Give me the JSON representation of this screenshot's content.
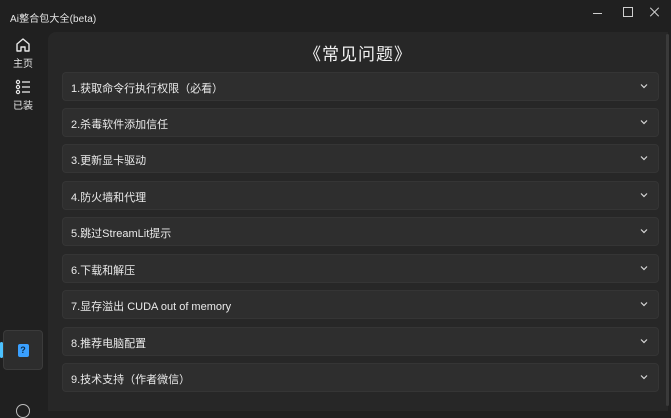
{
  "window": {
    "title": "Ai整合包大全(beta)"
  },
  "sidebar": {
    "items": [
      {
        "label": "主页",
        "icon": "home-icon"
      },
      {
        "label": "已装",
        "icon": "list-icon"
      }
    ],
    "active_item": {
      "icon": "help-book-icon",
      "glyph": "?"
    }
  },
  "main": {
    "title": "《常见问题》",
    "faq": [
      "1.获取命令行执行权限（必看）",
      "2.杀毒软件添加信任",
      "3.更新显卡驱动",
      "4.防火墙和代理",
      "5.跳过StreamLit提示",
      "6.下载和解压",
      "7.显存溢出 CUDA out of memory",
      "8.推荐电脑配置",
      "9.技术支持（作者微信）"
    ]
  },
  "colors": {
    "accent": "#4cc2ff",
    "background": "#202020",
    "panel": "#272727",
    "row": "#2e2e2e"
  }
}
